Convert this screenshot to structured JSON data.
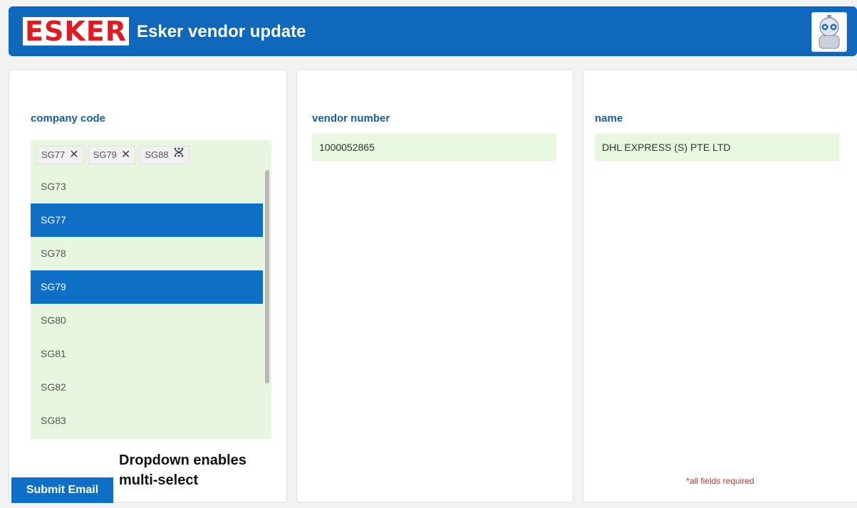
{
  "header": {
    "logo": "ESKER",
    "title": "Esker vendor update",
    "avatar_icon": "robot-avatar-icon"
  },
  "company_panel": {
    "label": "company code",
    "chips": [
      {
        "label": "SG77",
        "remove_icon": "close-icon"
      },
      {
        "label": "SG79",
        "remove_icon": "close-icon"
      },
      {
        "label": "SG88",
        "remove_icon": "clear-all-icon"
      }
    ],
    "options": [
      {
        "label": "SG73",
        "selected": false
      },
      {
        "label": "SG77",
        "selected": true
      },
      {
        "label": "SG78",
        "selected": false
      },
      {
        "label": "SG79",
        "selected": true
      },
      {
        "label": "SG80",
        "selected": false
      },
      {
        "label": "SG81",
        "selected": false
      },
      {
        "label": "SG82",
        "selected": false
      },
      {
        "label": "SG83",
        "selected": false
      }
    ],
    "annotation_line1": "Dropdown enables",
    "annotation_line2": "multi-select"
  },
  "vendor_panel": {
    "label": "vendor number",
    "value": "1000052865"
  },
  "name_panel": {
    "label": "name",
    "value": "DHL EXPRESS (S) PTE LTD",
    "required_note": "*all fields required"
  },
  "submit_label": "Submit Email",
  "colors": {
    "header_bg": "#1068bd",
    "selected_bg": "#0f6fc6",
    "field_bg": "#e8f7e0",
    "logo_red": "#e11b22"
  }
}
